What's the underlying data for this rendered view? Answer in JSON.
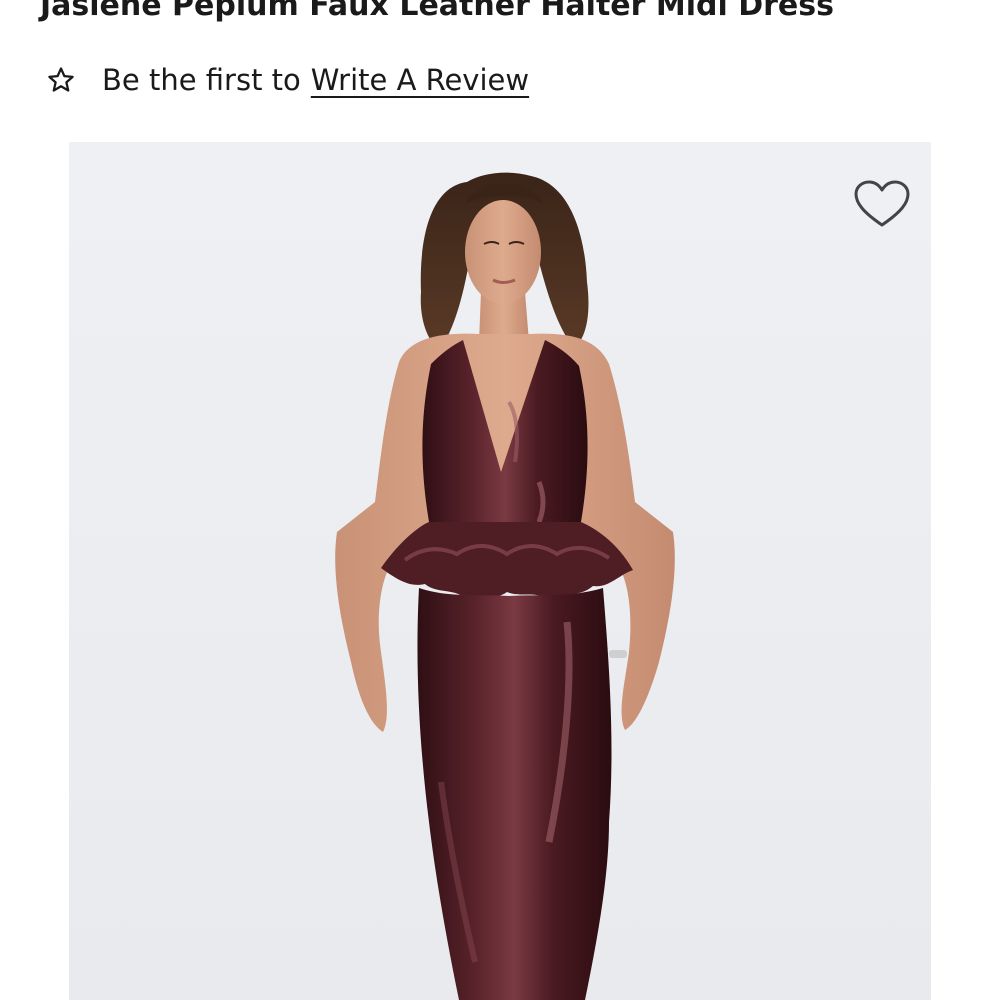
{
  "product": {
    "title": "Jaslene Peplum Faux Leather Halter Midi Dress"
  },
  "reviews": {
    "star_icon": "star-outline-icon",
    "prefix": "Be the first to",
    "link_label": "Write A Review"
  },
  "gallery": {
    "wishlist_icon": "heart-outline-icon",
    "image_alt": "Model wearing burgundy faux leather halter peplum midi dress",
    "background_color": "#eceef2",
    "dress_color": "#4a1c22"
  }
}
